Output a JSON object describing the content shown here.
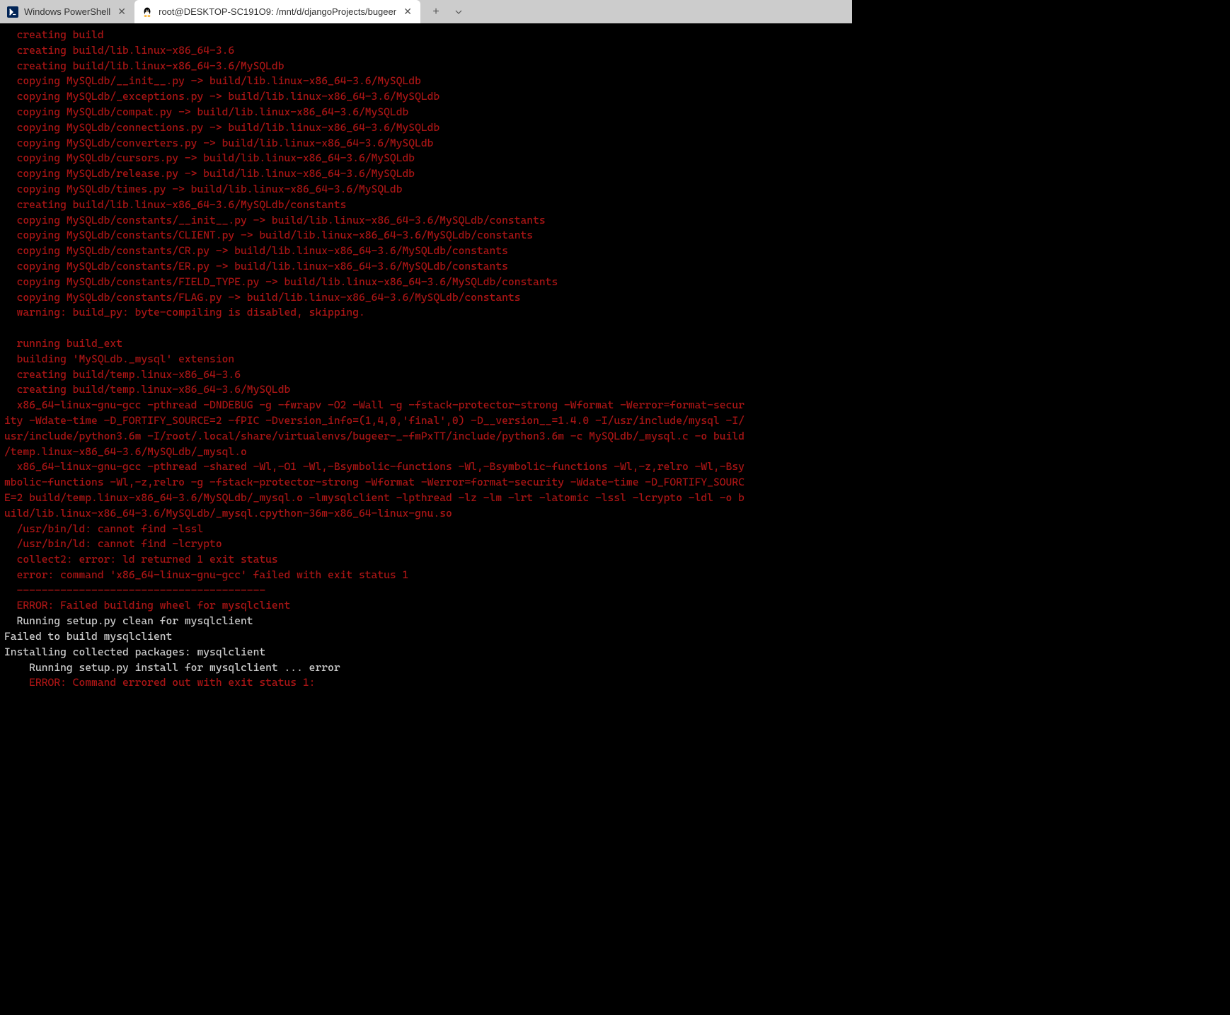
{
  "tabs": {
    "tab1": {
      "label": "Windows PowerShell"
    },
    "tab2": {
      "label": "root@DESKTOP-SC191O9: /mnt/d/djangoProjects/bugeer"
    }
  },
  "terminal": {
    "lines": [
      {
        "class": "red",
        "text": "  creating build"
      },
      {
        "class": "red",
        "text": "  creating build/lib.linux-x86_64-3.6"
      },
      {
        "class": "red",
        "text": "  creating build/lib.linux-x86_64-3.6/MySQLdb"
      },
      {
        "class": "red",
        "text": "  copying MySQLdb/__init__.py -> build/lib.linux-x86_64-3.6/MySQLdb"
      },
      {
        "class": "red",
        "text": "  copying MySQLdb/_exceptions.py -> build/lib.linux-x86_64-3.6/MySQLdb"
      },
      {
        "class": "red",
        "text": "  copying MySQLdb/compat.py -> build/lib.linux-x86_64-3.6/MySQLdb"
      },
      {
        "class": "red",
        "text": "  copying MySQLdb/connections.py -> build/lib.linux-x86_64-3.6/MySQLdb"
      },
      {
        "class": "red",
        "text": "  copying MySQLdb/converters.py -> build/lib.linux-x86_64-3.6/MySQLdb"
      },
      {
        "class": "red",
        "text": "  copying MySQLdb/cursors.py -> build/lib.linux-x86_64-3.6/MySQLdb"
      },
      {
        "class": "red",
        "text": "  copying MySQLdb/release.py -> build/lib.linux-x86_64-3.6/MySQLdb"
      },
      {
        "class": "red",
        "text": "  copying MySQLdb/times.py -> build/lib.linux-x86_64-3.6/MySQLdb"
      },
      {
        "class": "red",
        "text": "  creating build/lib.linux-x86_64-3.6/MySQLdb/constants"
      },
      {
        "class": "red",
        "text": "  copying MySQLdb/constants/__init__.py -> build/lib.linux-x86_64-3.6/MySQLdb/constants"
      },
      {
        "class": "red",
        "text": "  copying MySQLdb/constants/CLIENT.py -> build/lib.linux-x86_64-3.6/MySQLdb/constants"
      },
      {
        "class": "red",
        "text": "  copying MySQLdb/constants/CR.py -> build/lib.linux-x86_64-3.6/MySQLdb/constants"
      },
      {
        "class": "red",
        "text": "  copying MySQLdb/constants/ER.py -> build/lib.linux-x86_64-3.6/MySQLdb/constants"
      },
      {
        "class": "red",
        "text": "  copying MySQLdb/constants/FIELD_TYPE.py -> build/lib.linux-x86_64-3.6/MySQLdb/constants"
      },
      {
        "class": "red",
        "text": "  copying MySQLdb/constants/FLAG.py -> build/lib.linux-x86_64-3.6/MySQLdb/constants"
      },
      {
        "class": "red",
        "text": "  warning: build_py: byte-compiling is disabled, skipping."
      },
      {
        "class": "red",
        "text": ""
      },
      {
        "class": "red",
        "text": "  running build_ext"
      },
      {
        "class": "red",
        "text": "  building 'MySQLdb._mysql' extension"
      },
      {
        "class": "red",
        "text": "  creating build/temp.linux-x86_64-3.6"
      },
      {
        "class": "red",
        "text": "  creating build/temp.linux-x86_64-3.6/MySQLdb"
      },
      {
        "class": "red",
        "text": "  x86_64-linux-gnu-gcc -pthread -DNDEBUG -g -fwrapv -O2 -Wall -g -fstack-protector-strong -Wformat -Werror=format-secur"
      },
      {
        "class": "red",
        "text": "ity -Wdate-time -D_FORTIFY_SOURCE=2 -fPIC -Dversion_info=(1,4,0,'final',0) -D__version__=1.4.0 -I/usr/include/mysql -I/"
      },
      {
        "class": "red",
        "text": "usr/include/python3.6m -I/root/.local/share/virtualenvs/bugeer-_-fmPxTT/include/python3.6m -c MySQLdb/_mysql.c -o build"
      },
      {
        "class": "red",
        "text": "/temp.linux-x86_64-3.6/MySQLdb/_mysql.o"
      },
      {
        "class": "red",
        "text": "  x86_64-linux-gnu-gcc -pthread -shared -Wl,-O1 -Wl,-Bsymbolic-functions -Wl,-Bsymbolic-functions -Wl,-z,relro -Wl,-Bsy"
      },
      {
        "class": "red",
        "text": "mbolic-functions -Wl,-z,relro -g -fstack-protector-strong -Wformat -Werror=format-security -Wdate-time -D_FORTIFY_SOURC"
      },
      {
        "class": "red",
        "text": "E=2 build/temp.linux-x86_64-3.6/MySQLdb/_mysql.o -lmysqlclient -lpthread -lz -lm -lrt -latomic -lssl -lcrypto -ldl -o b"
      },
      {
        "class": "red",
        "text": "uild/lib.linux-x86_64-3.6/MySQLdb/_mysql.cpython-36m-x86_64-linux-gnu.so"
      },
      {
        "class": "red",
        "text": "  /usr/bin/ld: cannot find -lssl"
      },
      {
        "class": "red",
        "text": "  /usr/bin/ld: cannot find -lcrypto"
      },
      {
        "class": "red",
        "text": "  collect2: error: ld returned 1 exit status"
      },
      {
        "class": "red",
        "text": "  error: command 'x86_64-linux-gnu-gcc' failed with exit status 1"
      },
      {
        "class": "red",
        "text": "  ----------------------------------------"
      },
      {
        "class": "red",
        "text": "  ERROR: Failed building wheel for mysqlclient"
      },
      {
        "class": "white",
        "text": "  Running setup.py clean for mysqlclient"
      },
      {
        "class": "white",
        "text": "Failed to build mysqlclient"
      },
      {
        "class": "white",
        "text": "Installing collected packages: mysqlclient"
      },
      {
        "class": "white",
        "text": "    Running setup.py install for mysqlclient ... error"
      },
      {
        "class": "red",
        "text": "    ERROR: Command errored out with exit status 1:"
      }
    ]
  }
}
